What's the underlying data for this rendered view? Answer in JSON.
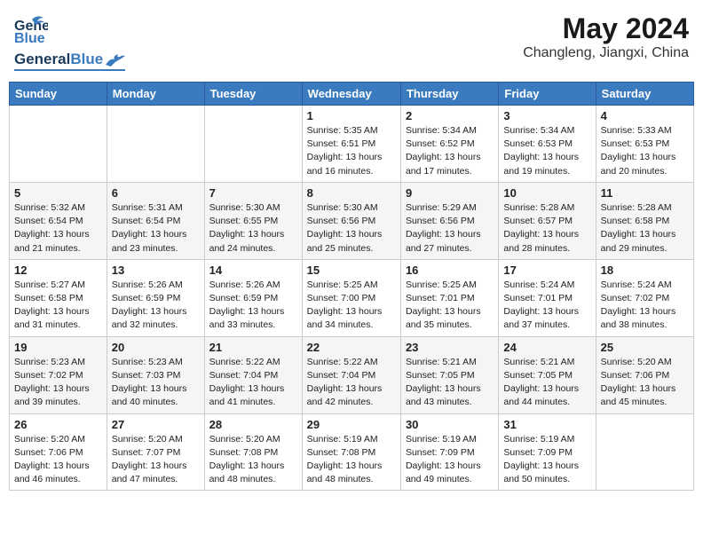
{
  "header": {
    "logo_general": "General",
    "logo_blue": "Blue",
    "month_year": "May 2024",
    "location": "Changleng, Jiangxi, China"
  },
  "days_of_week": [
    "Sunday",
    "Monday",
    "Tuesday",
    "Wednesday",
    "Thursday",
    "Friday",
    "Saturday"
  ],
  "weeks": [
    {
      "days": [
        {
          "num": "",
          "info": ""
        },
        {
          "num": "",
          "info": ""
        },
        {
          "num": "",
          "info": ""
        },
        {
          "num": "1",
          "info": "Sunrise: 5:35 AM\nSunset: 6:51 PM\nDaylight: 13 hours and 16 minutes."
        },
        {
          "num": "2",
          "info": "Sunrise: 5:34 AM\nSunset: 6:52 PM\nDaylight: 13 hours and 17 minutes."
        },
        {
          "num": "3",
          "info": "Sunrise: 5:34 AM\nSunset: 6:53 PM\nDaylight: 13 hours and 19 minutes."
        },
        {
          "num": "4",
          "info": "Sunrise: 5:33 AM\nSunset: 6:53 PM\nDaylight: 13 hours and 20 minutes."
        }
      ]
    },
    {
      "days": [
        {
          "num": "5",
          "info": "Sunrise: 5:32 AM\nSunset: 6:54 PM\nDaylight: 13 hours and 21 minutes."
        },
        {
          "num": "6",
          "info": "Sunrise: 5:31 AM\nSunset: 6:54 PM\nDaylight: 13 hours and 23 minutes."
        },
        {
          "num": "7",
          "info": "Sunrise: 5:30 AM\nSunset: 6:55 PM\nDaylight: 13 hours and 24 minutes."
        },
        {
          "num": "8",
          "info": "Sunrise: 5:30 AM\nSunset: 6:56 PM\nDaylight: 13 hours and 25 minutes."
        },
        {
          "num": "9",
          "info": "Sunrise: 5:29 AM\nSunset: 6:56 PM\nDaylight: 13 hours and 27 minutes."
        },
        {
          "num": "10",
          "info": "Sunrise: 5:28 AM\nSunset: 6:57 PM\nDaylight: 13 hours and 28 minutes."
        },
        {
          "num": "11",
          "info": "Sunrise: 5:28 AM\nSunset: 6:58 PM\nDaylight: 13 hours and 29 minutes."
        }
      ]
    },
    {
      "days": [
        {
          "num": "12",
          "info": "Sunrise: 5:27 AM\nSunset: 6:58 PM\nDaylight: 13 hours and 31 minutes."
        },
        {
          "num": "13",
          "info": "Sunrise: 5:26 AM\nSunset: 6:59 PM\nDaylight: 13 hours and 32 minutes."
        },
        {
          "num": "14",
          "info": "Sunrise: 5:26 AM\nSunset: 6:59 PM\nDaylight: 13 hours and 33 minutes."
        },
        {
          "num": "15",
          "info": "Sunrise: 5:25 AM\nSunset: 7:00 PM\nDaylight: 13 hours and 34 minutes."
        },
        {
          "num": "16",
          "info": "Sunrise: 5:25 AM\nSunset: 7:01 PM\nDaylight: 13 hours and 35 minutes."
        },
        {
          "num": "17",
          "info": "Sunrise: 5:24 AM\nSunset: 7:01 PM\nDaylight: 13 hours and 37 minutes."
        },
        {
          "num": "18",
          "info": "Sunrise: 5:24 AM\nSunset: 7:02 PM\nDaylight: 13 hours and 38 minutes."
        }
      ]
    },
    {
      "days": [
        {
          "num": "19",
          "info": "Sunrise: 5:23 AM\nSunset: 7:02 PM\nDaylight: 13 hours and 39 minutes."
        },
        {
          "num": "20",
          "info": "Sunrise: 5:23 AM\nSunset: 7:03 PM\nDaylight: 13 hours and 40 minutes."
        },
        {
          "num": "21",
          "info": "Sunrise: 5:22 AM\nSunset: 7:04 PM\nDaylight: 13 hours and 41 minutes."
        },
        {
          "num": "22",
          "info": "Sunrise: 5:22 AM\nSunset: 7:04 PM\nDaylight: 13 hours and 42 minutes."
        },
        {
          "num": "23",
          "info": "Sunrise: 5:21 AM\nSunset: 7:05 PM\nDaylight: 13 hours and 43 minutes."
        },
        {
          "num": "24",
          "info": "Sunrise: 5:21 AM\nSunset: 7:05 PM\nDaylight: 13 hours and 44 minutes."
        },
        {
          "num": "25",
          "info": "Sunrise: 5:20 AM\nSunset: 7:06 PM\nDaylight: 13 hours and 45 minutes."
        }
      ]
    },
    {
      "days": [
        {
          "num": "26",
          "info": "Sunrise: 5:20 AM\nSunset: 7:06 PM\nDaylight: 13 hours and 46 minutes."
        },
        {
          "num": "27",
          "info": "Sunrise: 5:20 AM\nSunset: 7:07 PM\nDaylight: 13 hours and 47 minutes."
        },
        {
          "num": "28",
          "info": "Sunrise: 5:20 AM\nSunset: 7:08 PM\nDaylight: 13 hours and 48 minutes."
        },
        {
          "num": "29",
          "info": "Sunrise: 5:19 AM\nSunset: 7:08 PM\nDaylight: 13 hours and 48 minutes."
        },
        {
          "num": "30",
          "info": "Sunrise: 5:19 AM\nSunset: 7:09 PM\nDaylight: 13 hours and 49 minutes."
        },
        {
          "num": "31",
          "info": "Sunrise: 5:19 AM\nSunset: 7:09 PM\nDaylight: 13 hours and 50 minutes."
        },
        {
          "num": "",
          "info": ""
        }
      ]
    }
  ]
}
